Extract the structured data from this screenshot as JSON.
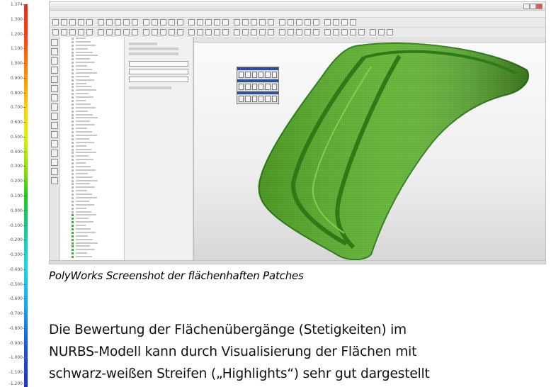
{
  "scale": {
    "ticks": [
      "1.374",
      "1.300",
      "1.200",
      "1.100",
      "1.000",
      "0.900",
      "0.800",
      "0.700",
      "0.600",
      "0.500",
      "0.400",
      "0.300",
      "0.200",
      "0.100",
      "0.000",
      "-0.100",
      "-0.200",
      "-0.300",
      "-0.400",
      "-0.500",
      "-0.600",
      "-0.700",
      "-0.800",
      "-0.900",
      "-1.000",
      "-1.100",
      "-1.200"
    ]
  },
  "caption": "PolyWorks Screenshot der flächenhaften Patches",
  "body": {
    "lines": [
      "Die Bewertung der Flächenübergänge (Stetigkeiten) im",
      "NURBS-Modell kann durch Visualisierung der Flächen mit",
      "schwarz-weißen Streifen („Highlights“)  sehr gut dargestellt"
    ]
  },
  "colors": {
    "surface": "#4fa52a",
    "surface_dark": "#2f7d1a"
  },
  "icons": [
    "window-control-icon",
    "tool-icon",
    "surface-model"
  ]
}
